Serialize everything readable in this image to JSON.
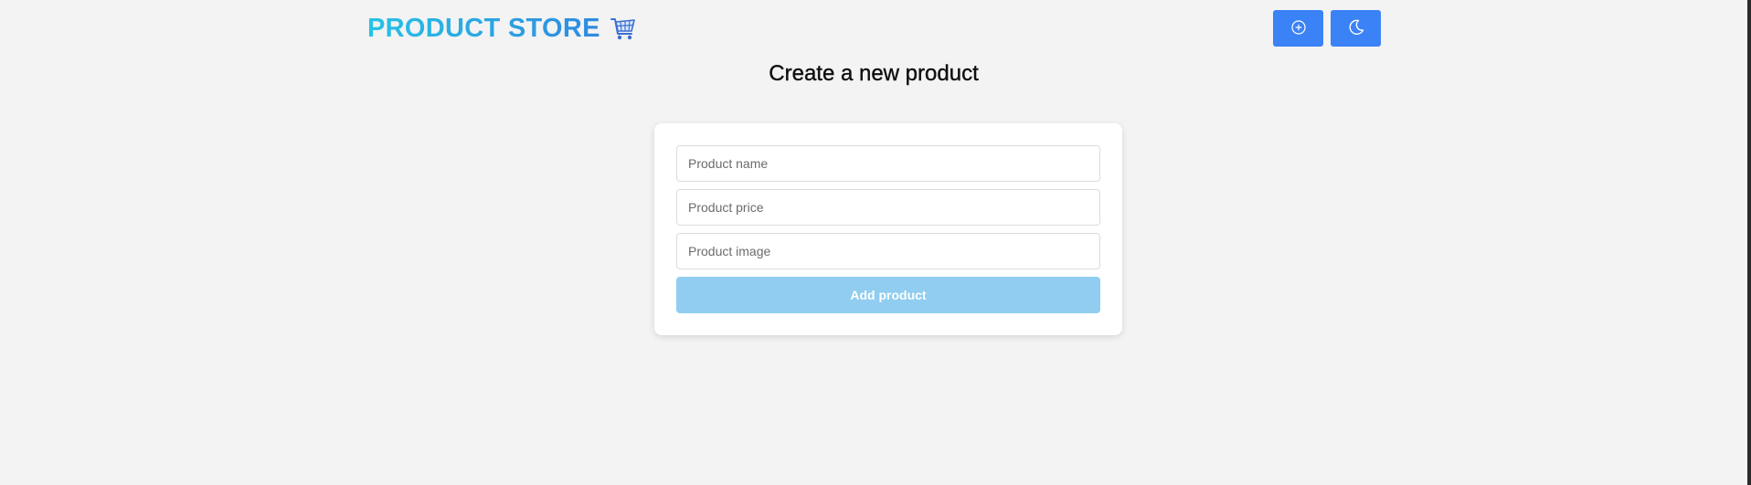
{
  "navbar": {
    "brand": "PRODUCT STORE",
    "brand_icon": "shopping-cart-icon",
    "actions": [
      {
        "icon": "plus-circle-icon"
      },
      {
        "icon": "moon-icon"
      }
    ]
  },
  "page": {
    "title": "Create a new product"
  },
  "form": {
    "name_placeholder": "Product name",
    "price_placeholder": "Product price",
    "image_placeholder": "Product image",
    "submit_label": "Add product"
  },
  "colors": {
    "background": "#f3f3f3",
    "brand_gradient_start": "#27c2e6",
    "brand_gradient_end": "#2f8ae0",
    "nav_button": "#3b82f6",
    "submit_button": "#90cdf0"
  }
}
